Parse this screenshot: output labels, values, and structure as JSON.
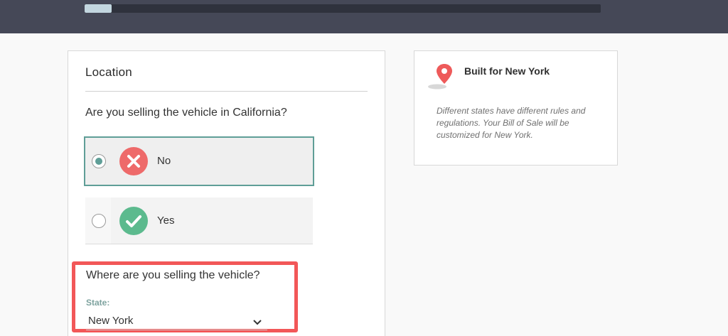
{
  "progress": {
    "percent": 5.2
  },
  "location": {
    "title": "Location",
    "question": "Are you selling the vehicle in California?",
    "options": [
      {
        "label": "No",
        "selected": true,
        "icon": "x-circle-icon"
      },
      {
        "label": "Yes",
        "selected": false,
        "icon": "check-circle-icon"
      }
    ],
    "where_question": "Where are you selling the vehicle?",
    "state_label": "State:",
    "state_value": "New York"
  },
  "info": {
    "title": "Built for New York",
    "text": "Different states have different rules and regulations. Your Bill of Sale will be customized for New York.",
    "icon": "map-pin-icon"
  },
  "colors": {
    "topbar": "#454857",
    "accent": "#5f9e97",
    "no": "#ee6a6a",
    "yes": "#5cba8e",
    "highlight": "#f25758"
  }
}
